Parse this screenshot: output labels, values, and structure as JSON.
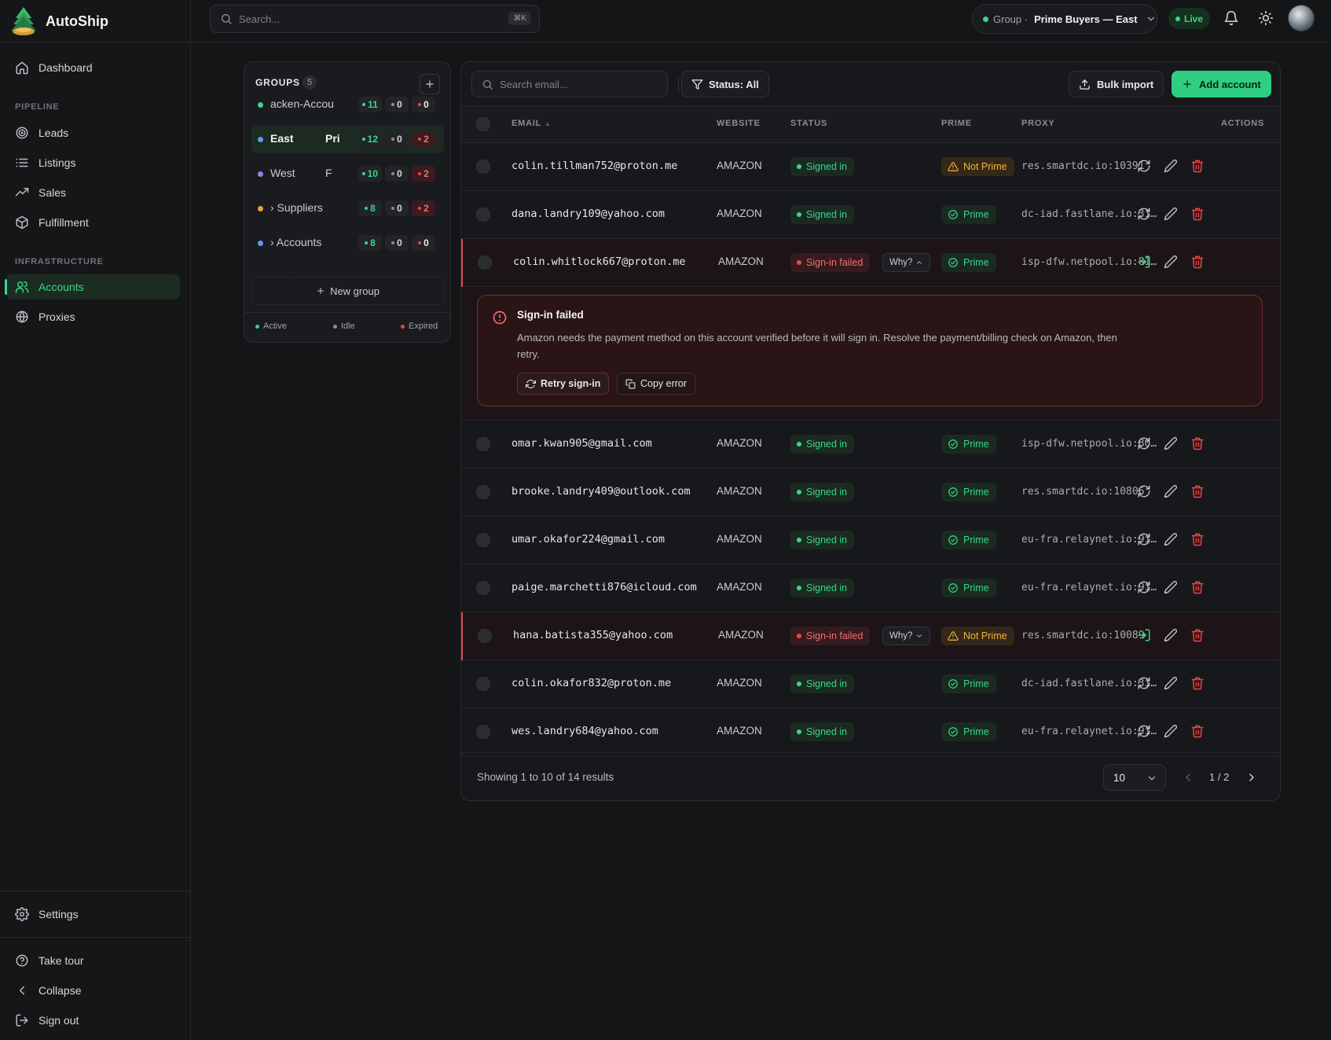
{
  "app": {
    "name": "AutoShip"
  },
  "search": {
    "placeholder": "Search...",
    "shortcut": "⌘K"
  },
  "sidebar": {
    "items": [
      {
        "label": "Dashboard",
        "icon": "home-icon"
      },
      {
        "label": "Leads",
        "icon": "target-icon"
      },
      {
        "label": "Listings",
        "icon": "list-icon"
      },
      {
        "label": "Sales",
        "icon": "trending-up-icon"
      },
      {
        "label": "Fulfillment",
        "icon": "package-icon"
      },
      {
        "label": "Accounts",
        "icon": "users-icon",
        "active": true
      },
      {
        "label": "Proxies",
        "icon": "globe-icon"
      }
    ],
    "sections": {
      "pipeline": "PIPELINE",
      "infrastructure": "INFRASTRUCTURE"
    },
    "bottom": {
      "settings": "Settings",
      "tour": "Take tour",
      "collapse": "Collapse",
      "signout": "Sign out"
    }
  },
  "topbar": {
    "group_prefix": "Group ·",
    "group_name": "Prime Buyers — East",
    "live": "Live"
  },
  "groups": {
    "title": "GROUPS",
    "count": "5",
    "items": [
      {
        "name": "acken-Accou",
        "extra": "",
        "dot": "#3ad68a",
        "active": "11",
        "idle": "0",
        "expired": "0"
      },
      {
        "name": "East",
        "extra": "Pri",
        "dot": "#5b9cf0",
        "active": "12",
        "idle": "0",
        "expired": "2",
        "selected": true
      },
      {
        "name": " West",
        "extra": "F",
        "dot": "#9d7bf0",
        "active": "10",
        "idle": "0",
        "expired": "2"
      },
      {
        "name": "› Suppliers",
        "extra": "",
        "dot": "#f0a040",
        "active": "8",
        "idle": "0",
        "expired": "2"
      },
      {
        "name": "› Accounts",
        "extra": "",
        "dot": "#5b9cf0",
        "active": "8",
        "idle": "0",
        "expired": "0"
      }
    ],
    "new_group": "New group",
    "legend": {
      "active": "Active",
      "idle": "Idle",
      "expired": "Expired"
    }
  },
  "accounts": {
    "search_placeholder": "Search email...",
    "status_filter": "Status: All",
    "bulk_import": "Bulk import",
    "add_account": "Add account",
    "columns": {
      "email": "EMAIL",
      "website": "WEBSITE",
      "status": "STATUS",
      "prime": "PRIME",
      "proxy": "PROXY",
      "actions": "ACTIONS"
    },
    "rows": [
      {
        "email": "colin.tillman752@proton.me",
        "website": "AMAZON",
        "status": "Signed in",
        "failed": false,
        "prime": "Not Prime",
        "is_prime": false,
        "proxy": "res.smartdc.io:10391"
      },
      {
        "email": "dana.landry109@yahoo.com",
        "website": "AMAZON",
        "status": "Signed in",
        "failed": false,
        "prime": "Prime",
        "is_prime": true,
        "proxy": "dc-iad.fastlane.io:31…"
      },
      {
        "email": "colin.whitlock667@proton.me",
        "website": "AMAZON",
        "status": "Sign-in failed",
        "failed": true,
        "why": "Why?",
        "why_open": true,
        "prime": "Prime",
        "is_prime": true,
        "proxy": "isp-dfw.netpool.io:81…"
      },
      {
        "email": "omar.kwan905@gmail.com",
        "website": "AMAZON",
        "status": "Signed in",
        "failed": false,
        "prime": "Prime",
        "is_prime": true,
        "proxy": "isp-dfw.netpool.io:80…"
      },
      {
        "email": "brooke.landry409@outlook.com",
        "website": "AMAZON",
        "status": "Signed in",
        "failed": false,
        "prime": "Prime",
        "is_prime": true,
        "proxy": "res.smartdc.io:10806"
      },
      {
        "email": "umar.okafor224@gmail.com",
        "website": "AMAZON",
        "status": "Signed in",
        "failed": false,
        "prime": "Prime",
        "is_prime": true,
        "proxy": "eu-fra.relaynet.io:91…"
      },
      {
        "email": "paige.marchetti876@icloud.com",
        "website": "AMAZON",
        "status": "Signed in",
        "failed": false,
        "prime": "Prime",
        "is_prime": true,
        "proxy": "eu-fra.relaynet.io:91…"
      },
      {
        "email": "hana.batista355@yahoo.com",
        "website": "AMAZON",
        "status": "Sign-in failed",
        "failed": true,
        "why": "Why?",
        "why_open": false,
        "prime": "Not Prime",
        "is_prime": false,
        "proxy": "res.smartdc.io:10089"
      },
      {
        "email": "colin.okafor832@proton.me",
        "website": "AMAZON",
        "status": "Signed in",
        "failed": false,
        "prime": "Prime",
        "is_prime": true,
        "proxy": "dc-iad.fastlane.io:31…"
      },
      {
        "email": "wes.landry684@yahoo.com",
        "website": "AMAZON",
        "status": "Signed in",
        "failed": false,
        "prime": "Prime",
        "is_prime": true,
        "proxy": "eu-fra.relaynet.io:91…"
      }
    ],
    "error": {
      "title": "Sign-in failed",
      "message": "Amazon needs the payment method on this account verified before it will sign in. Resolve the payment/billing check on Amazon, then retry.",
      "retry": "Retry sign-in",
      "copy": "Copy error"
    },
    "footer": {
      "showing": "Showing 1 to 10 of 14 results",
      "page_size": "10",
      "page": "1 / 2"
    }
  }
}
